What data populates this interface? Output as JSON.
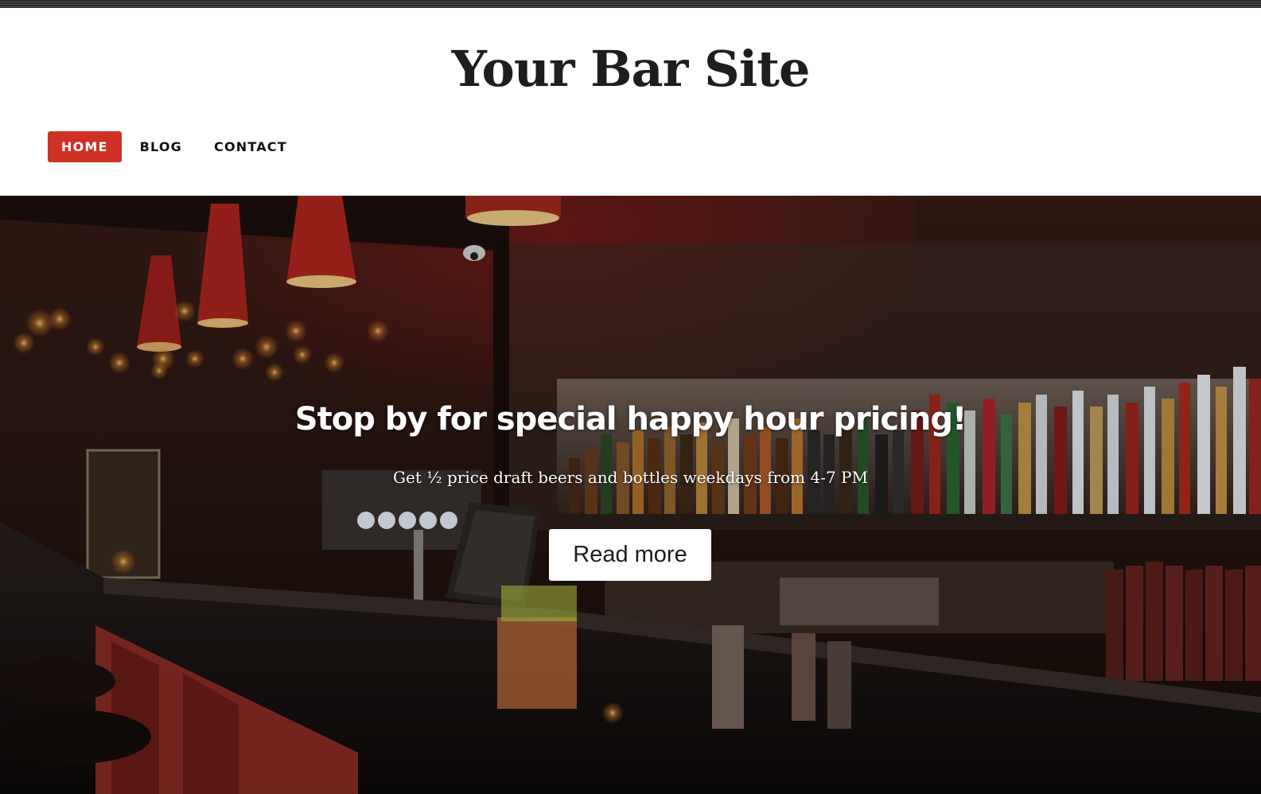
{
  "site": {
    "title": "Your Bar Site"
  },
  "nav": {
    "items": [
      {
        "label": "HOME",
        "active": true
      },
      {
        "label": "BLOG",
        "active": false
      },
      {
        "label": "CONTACT",
        "active": false
      }
    ]
  },
  "hero": {
    "heading": "Stop by for special happy hour pricing!",
    "subheading": "Get ½ price draft beers and bottles weekdays from 4-7 PM",
    "button_label": "Read more"
  },
  "colors": {
    "accent": "#cf3126",
    "title": "#1e1e1e",
    "nav_text": "#111111"
  }
}
